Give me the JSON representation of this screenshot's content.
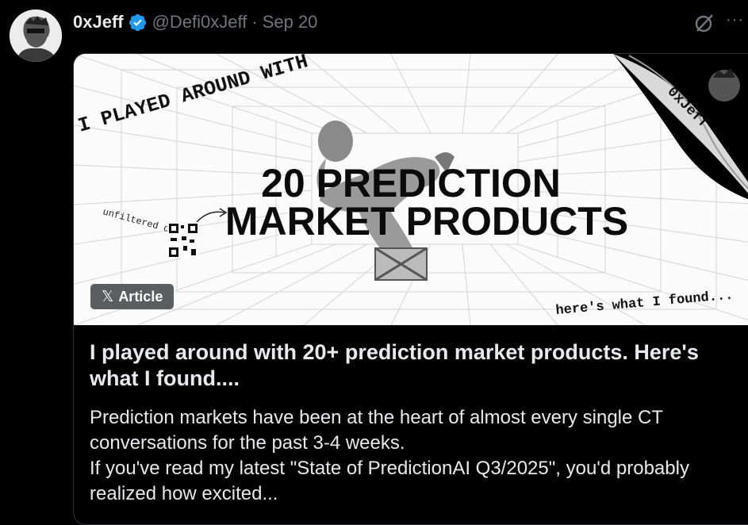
{
  "author": {
    "name": "0xJeff",
    "handle": "@Defi0xJeff",
    "separator": "·",
    "date": "Sep 20"
  },
  "header_icons": [
    "verified-badge-icon",
    "grok-icon",
    "more-icon"
  ],
  "article": {
    "cover": {
      "top_script": "I PLAYED AROUND WITH",
      "headline_line1": "20 PREDICTION",
      "headline_line2": "MARKET PRODUCTS",
      "unfiltered_note": "unfiltered on",
      "bottom_script": "here's what I found...",
      "sticker_text": "0xJeff"
    },
    "badge_label": "Article",
    "title": "I played around with 20+ prediction market products. Here's what I found....",
    "body_line1": "Prediction markets have been at the heart of almost every single CT conversations for the past 3-4 weeks.",
    "body_line2": "If you've read my latest \"State of PredictionAI Q3/2025\", you'd probably realized how excited..."
  },
  "colors": {
    "background": "#000000",
    "text": "#e7e9ea",
    "secondary": "#71767b",
    "verified": "#1d9bf0",
    "badge_bg": "#5b5d5f"
  }
}
